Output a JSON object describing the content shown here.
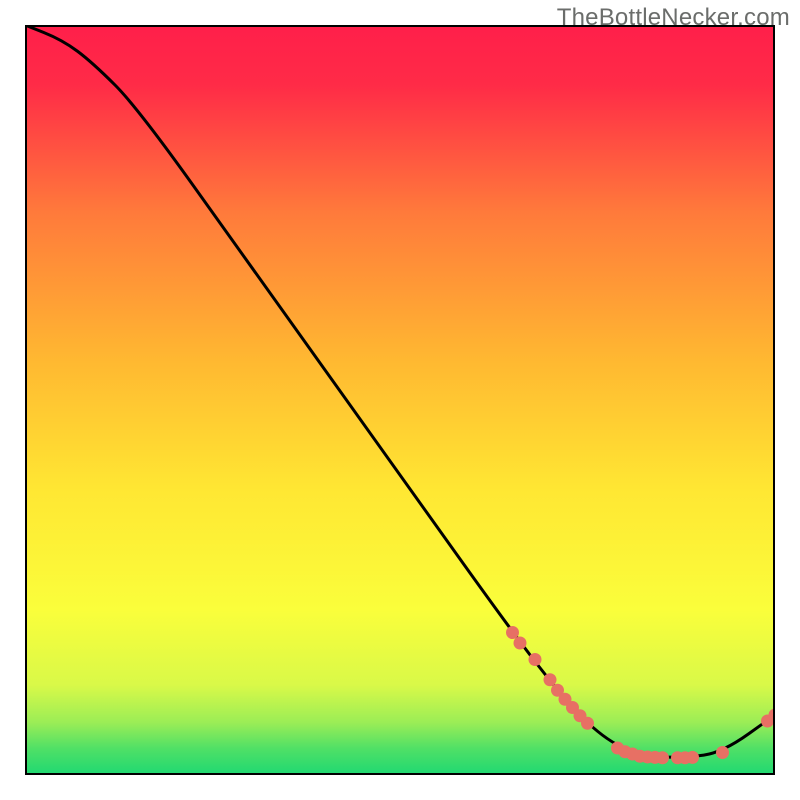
{
  "watermark": "TheBottleNecker.com",
  "colors": {
    "gradient_top": "#ff1f4a",
    "gradient_mid_upper": "#febb2f",
    "gradient_mid_lower": "#fff835",
    "gradient_bottom": "#1fdc71",
    "curve": "#000000",
    "marker": "#e77064",
    "frame": "#000000"
  },
  "chart_data": {
    "type": "line",
    "title": "",
    "xlabel": "",
    "ylabel": "",
    "xlim": [
      0,
      100
    ],
    "ylim": [
      0,
      100
    ],
    "curve": [
      {
        "x": 0,
        "y": 100
      },
      {
        "x": 5,
        "y": 98
      },
      {
        "x": 9,
        "y": 95
      },
      {
        "x": 15,
        "y": 89
      },
      {
        "x": 30,
        "y": 68
      },
      {
        "x": 50,
        "y": 40
      },
      {
        "x": 65,
        "y": 19
      },
      {
        "x": 72,
        "y": 10
      },
      {
        "x": 77,
        "y": 5
      },
      {
        "x": 82,
        "y": 2.5
      },
      {
        "x": 88,
        "y": 2.3
      },
      {
        "x": 93,
        "y": 3
      },
      {
        "x": 100,
        "y": 8
      }
    ],
    "points": [
      {
        "x": 65,
        "y": 19
      },
      {
        "x": 66,
        "y": 17.6
      },
      {
        "x": 68,
        "y": 15.4
      },
      {
        "x": 70,
        "y": 12.7
      },
      {
        "x": 71,
        "y": 11.3
      },
      {
        "x": 72,
        "y": 10.1
      },
      {
        "x": 73,
        "y": 9.0
      },
      {
        "x": 74,
        "y": 7.9
      },
      {
        "x": 75,
        "y": 6.9
      },
      {
        "x": 79,
        "y": 3.6
      },
      {
        "x": 80,
        "y": 3.1
      },
      {
        "x": 81,
        "y": 2.8
      },
      {
        "x": 82,
        "y": 2.5
      },
      {
        "x": 83,
        "y": 2.4
      },
      {
        "x": 84,
        "y": 2.35
      },
      {
        "x": 85,
        "y": 2.3
      },
      {
        "x": 87,
        "y": 2.3
      },
      {
        "x": 88,
        "y": 2.3
      },
      {
        "x": 89,
        "y": 2.35
      },
      {
        "x": 93,
        "y": 3.0
      },
      {
        "x": 99,
        "y": 7.2
      },
      {
        "x": 100,
        "y": 8.0
      }
    ]
  }
}
